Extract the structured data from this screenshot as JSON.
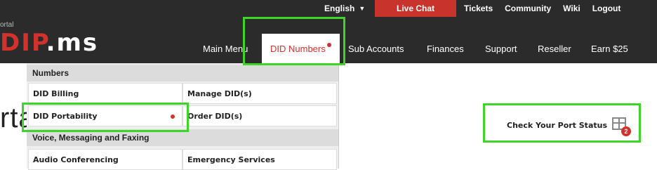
{
  "top_links": {
    "language": "English",
    "live_chat": "Live Chat",
    "tickets": "Tickets",
    "community": "Community",
    "wiki": "Wiki",
    "logout": "Logout"
  },
  "brand": {
    "portal_label": "ortal",
    "logo_red": "DIP",
    "logo_white": ".ms"
  },
  "main_nav": {
    "main_menu": "Main Menu",
    "did_numbers": "DID Numbers",
    "sub_accounts": "Sub Accounts",
    "finances": "Finances",
    "support": "Support",
    "reseller": "Reseller",
    "earn": "Earn $25"
  },
  "dropdown": {
    "section1": "Numbers",
    "did_billing": "DID Billing",
    "manage_dids": "Manage DID(s)",
    "did_portability": "DID Portability",
    "order_dids": "Order DID(s)",
    "section2": "Voice, Messaging and Faxing",
    "audio_conferencing": "Audio Conferencing",
    "emergency_services": "Emergency Services"
  },
  "page": {
    "title_fragment": "rta",
    "check_port_status": "Check Your Port Status",
    "badge_count": "2"
  },
  "colors": {
    "accent_red": "#d2312c",
    "highlight_green": "#3fd42a",
    "topbar": "#2b2b2b"
  }
}
